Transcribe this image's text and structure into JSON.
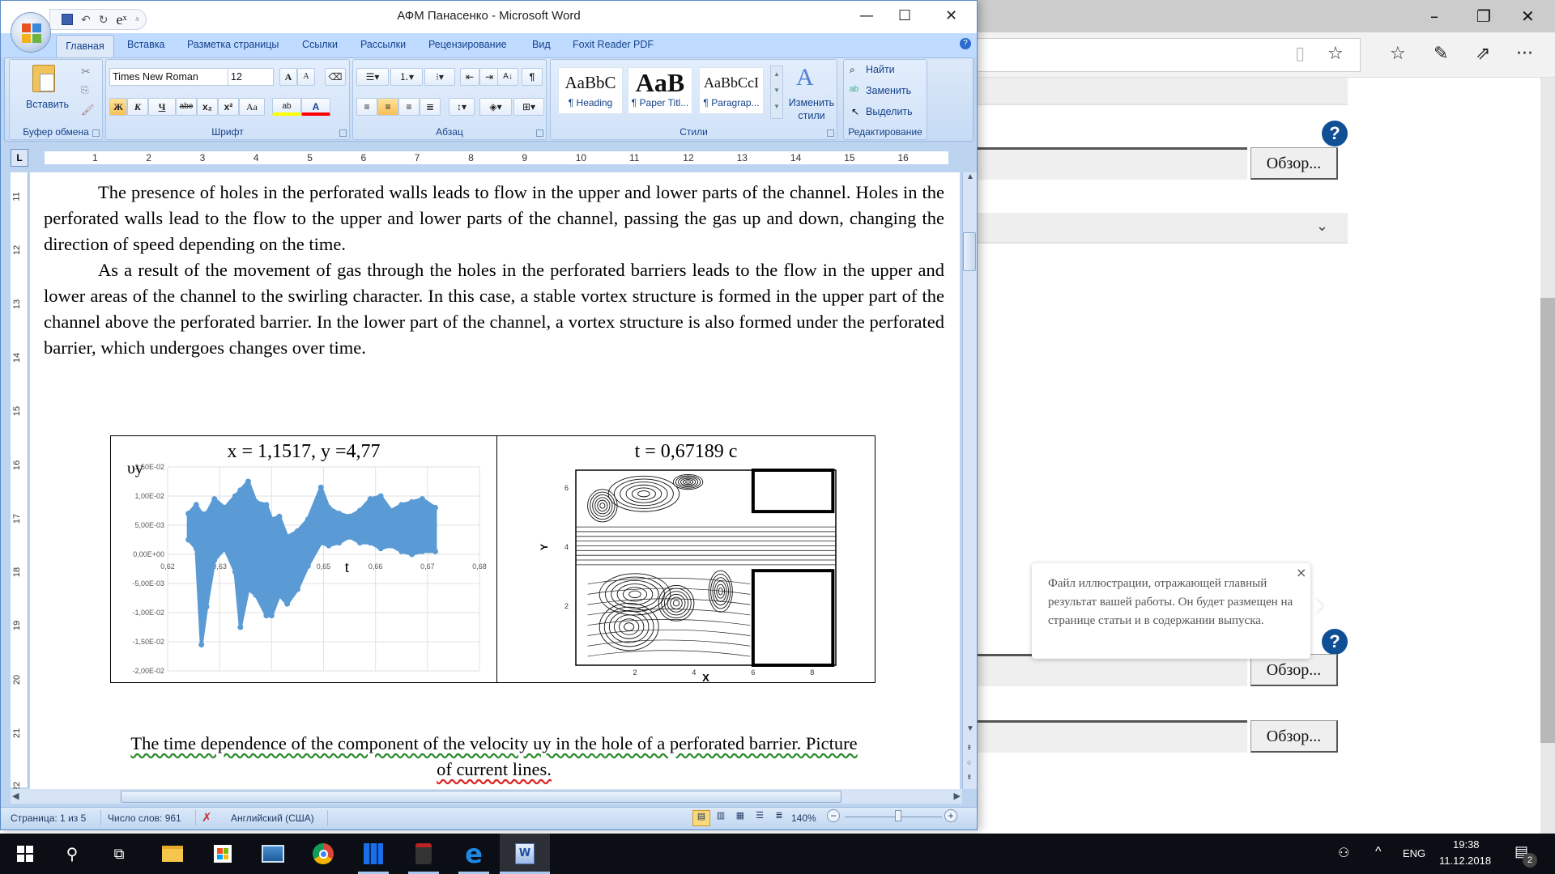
{
  "browser": {
    "window_controls": {
      "minimize": "–",
      "restore": "❐",
      "close": "✕"
    },
    "toolbar_icons": [
      "reading-view-icon",
      "favorite-star-icon",
      "favorites-hub-icon",
      "web-note-pen-icon",
      "share-icon",
      "more-icon"
    ],
    "more_label": "···",
    "browse_buttons": [
      "Обзор...",
      "Обзор...",
      "Обзор..."
    ],
    "help_label": "?",
    "chevron": "⌄",
    "tooltip": {
      "text": "Файл иллюстрации, отражающей главный результат вашей работы. Он будет размещен на странице статьи и в содержании выпуска.",
      "close": "×"
    }
  },
  "word": {
    "title": "АФМ Панасенко - Microsoft Word",
    "window_controls": {
      "minimize": "—",
      "maximize": "☐",
      "close": "✕"
    },
    "qat": {
      "save": "save-icon",
      "undo": "↶",
      "redo": "↻",
      "equation": "eˣ",
      "customize": "⩡"
    },
    "tabs": [
      "Главная",
      "Вставка",
      "Разметка страницы",
      "Ссылки",
      "Рассылки",
      "Рецензирование",
      "Вид",
      "Foxit Reader PDF"
    ],
    "active_tab": "Главная",
    "ribbon": {
      "clipboard": {
        "label": "Буфер обмена",
        "paste": "Вставить"
      },
      "font": {
        "label": "Шрифт",
        "font_name": "Times New Roman",
        "font_size": "12",
        "grow": "A",
        "shrink": "A",
        "bold": "Ж",
        "italic": "К",
        "underline": "Ч",
        "strike": "abe",
        "subscript": "x₂",
        "superscript": "x²",
        "case": "Aa",
        "highlight": "ab",
        "font_color": "A",
        "highlight_color": "#ffff00",
        "font_color_value": "#ff0000"
      },
      "paragraph": {
        "label": "Абзац",
        "pilcrow": "¶",
        "sort": "А↓"
      },
      "styles": {
        "label": "Стили",
        "items": [
          {
            "sample": "AaBbC",
            "name": "¶ Heading"
          },
          {
            "sample": "AaB",
            "name": "¶ Paper Titl..."
          },
          {
            "sample": "AaBbCcI",
            "name": "¶ Paragrap..."
          }
        ],
        "change_styles": "Изменить стили"
      },
      "editing": {
        "label": "Редактирование",
        "find": "Найти",
        "replace": "Заменить",
        "select": "Выделить"
      }
    },
    "ruler": {
      "h_numbers": [
        "1",
        "2",
        "3",
        "4",
        "5",
        "6",
        "7",
        "8",
        "9",
        "10",
        "11",
        "12",
        "13",
        "14",
        "15",
        "16"
      ],
      "v_numbers": [
        "11",
        "12",
        "13",
        "14",
        "15",
        "16",
        "17",
        "18",
        "19",
        "20",
        "21",
        "22"
      ],
      "corner": "L"
    },
    "document": {
      "paragraph1": "The presence of holes in the perforated walls leads to flow in the upper and lower parts of the channel. Holes in the perforated walls lead to the flow to the upper and lower parts of the channel, passing the gas up and down, changing the direction of speed depending on the time.",
      "paragraph2": "As a result of the movement of gas through the holes in the perforated barriers leads to the flow in the upper and lower areas of the channel to the swirling character. In this case, a stable vortex structure is formed in the upper part of the channel above the perforated barrier. In the lower part of the channel, a vortex structure is also formed under the perforated barrier, which undergoes changes over time.",
      "caption_line1": "The time dependence of the component of the velocity uy in the hole of a perforated barrier. Picture",
      "caption_line2": "of current lines."
    },
    "statusbar": {
      "page": "Страница: 1 из 5",
      "words": "Число слов: 961",
      "language": "Английский (США)",
      "zoom": "140%",
      "zoom_level_percent": 140
    }
  },
  "chart_data": [
    {
      "type": "scatter",
      "title": "x = 1,1517, y =4,77",
      "xlabel": "t",
      "ylabel": "υy",
      "xlim": [
        0.62,
        0.68
      ],
      "ylim": [
        -0.02,
        0.015
      ],
      "x_ticks": [
        "0,62",
        "0,63",
        "0,64",
        "0,65",
        "0,66",
        "0,67",
        "0,68"
      ],
      "y_ticks": [
        "1,50E-02",
        "1,00E-02",
        "5,00E-03",
        "0,00E+00",
        "-5,00E-03",
        "-1,00E-02",
        "-1,50E-02",
        "-2,00E-02"
      ],
      "grid": true,
      "series_color": "#5b9bd5",
      "envelope": {
        "t": [
          0.624,
          0.6255,
          0.6265,
          0.6275,
          0.629,
          0.631,
          0.633,
          0.634,
          0.6355,
          0.637,
          0.639,
          0.64,
          0.6415,
          0.643,
          0.645,
          0.647,
          0.6495,
          0.651,
          0.653,
          0.655,
          0.657,
          0.659,
          0.661,
          0.663,
          0.665,
          0.667,
          0.669,
          0.6715
        ],
        "upper": [
          0.007,
          0.0085,
          0.007,
          0.007,
          0.0095,
          0.008,
          0.01,
          0.011,
          0.0125,
          0.009,
          0.0085,
          0.006,
          0.0065,
          0.003,
          0.004,
          0.006,
          0.0115,
          0.008,
          0.007,
          0.0065,
          0.0075,
          0.0095,
          0.01,
          0.0075,
          0.0085,
          0.009,
          0.0095,
          0.008
        ],
        "lower": [
          0.0025,
          0.001,
          -0.0155,
          -0.009,
          -0.001,
          0.001,
          -0.003,
          -0.0125,
          -0.006,
          -0.007,
          -0.0105,
          -0.0105,
          -0.007,
          -0.0085,
          -0.006,
          -0.002,
          0.002,
          0.0015,
          0.002,
          0.003,
          0.002,
          0.002,
          0.001,
          0.0015,
          0.0005,
          0.0,
          0.0005,
          0.0005
        ]
      }
    },
    {
      "type": "streamlines",
      "title": "t = 0,67189 с",
      "xlabel": "X",
      "ylabel": "Y",
      "x_ticks": [
        "2",
        "4",
        "6",
        "8"
      ],
      "y_ticks": [
        "2",
        "4",
        "6"
      ],
      "xlim": [
        0,
        8.8
      ],
      "ylim": [
        0,
        6.6
      ],
      "barriers": [
        {
          "x0": 6.0,
          "x1": 8.7,
          "y0": 5.2,
          "y1": 6.6
        },
        {
          "x0": 6.0,
          "x1": 8.7,
          "y0": 0.0,
          "y1": 3.2
        }
      ],
      "channel": {
        "y0": 3.4,
        "y1": 4.8
      }
    }
  ],
  "taskbar": {
    "apps": [
      "start",
      "search",
      "task-view",
      "file-explorer",
      "store",
      "lenovo",
      "chrome",
      "app-blue",
      "app-gauge",
      "edge",
      "word"
    ],
    "language": "ENG",
    "time": "19:38",
    "date": "11.12.2018",
    "notifications": "2"
  }
}
